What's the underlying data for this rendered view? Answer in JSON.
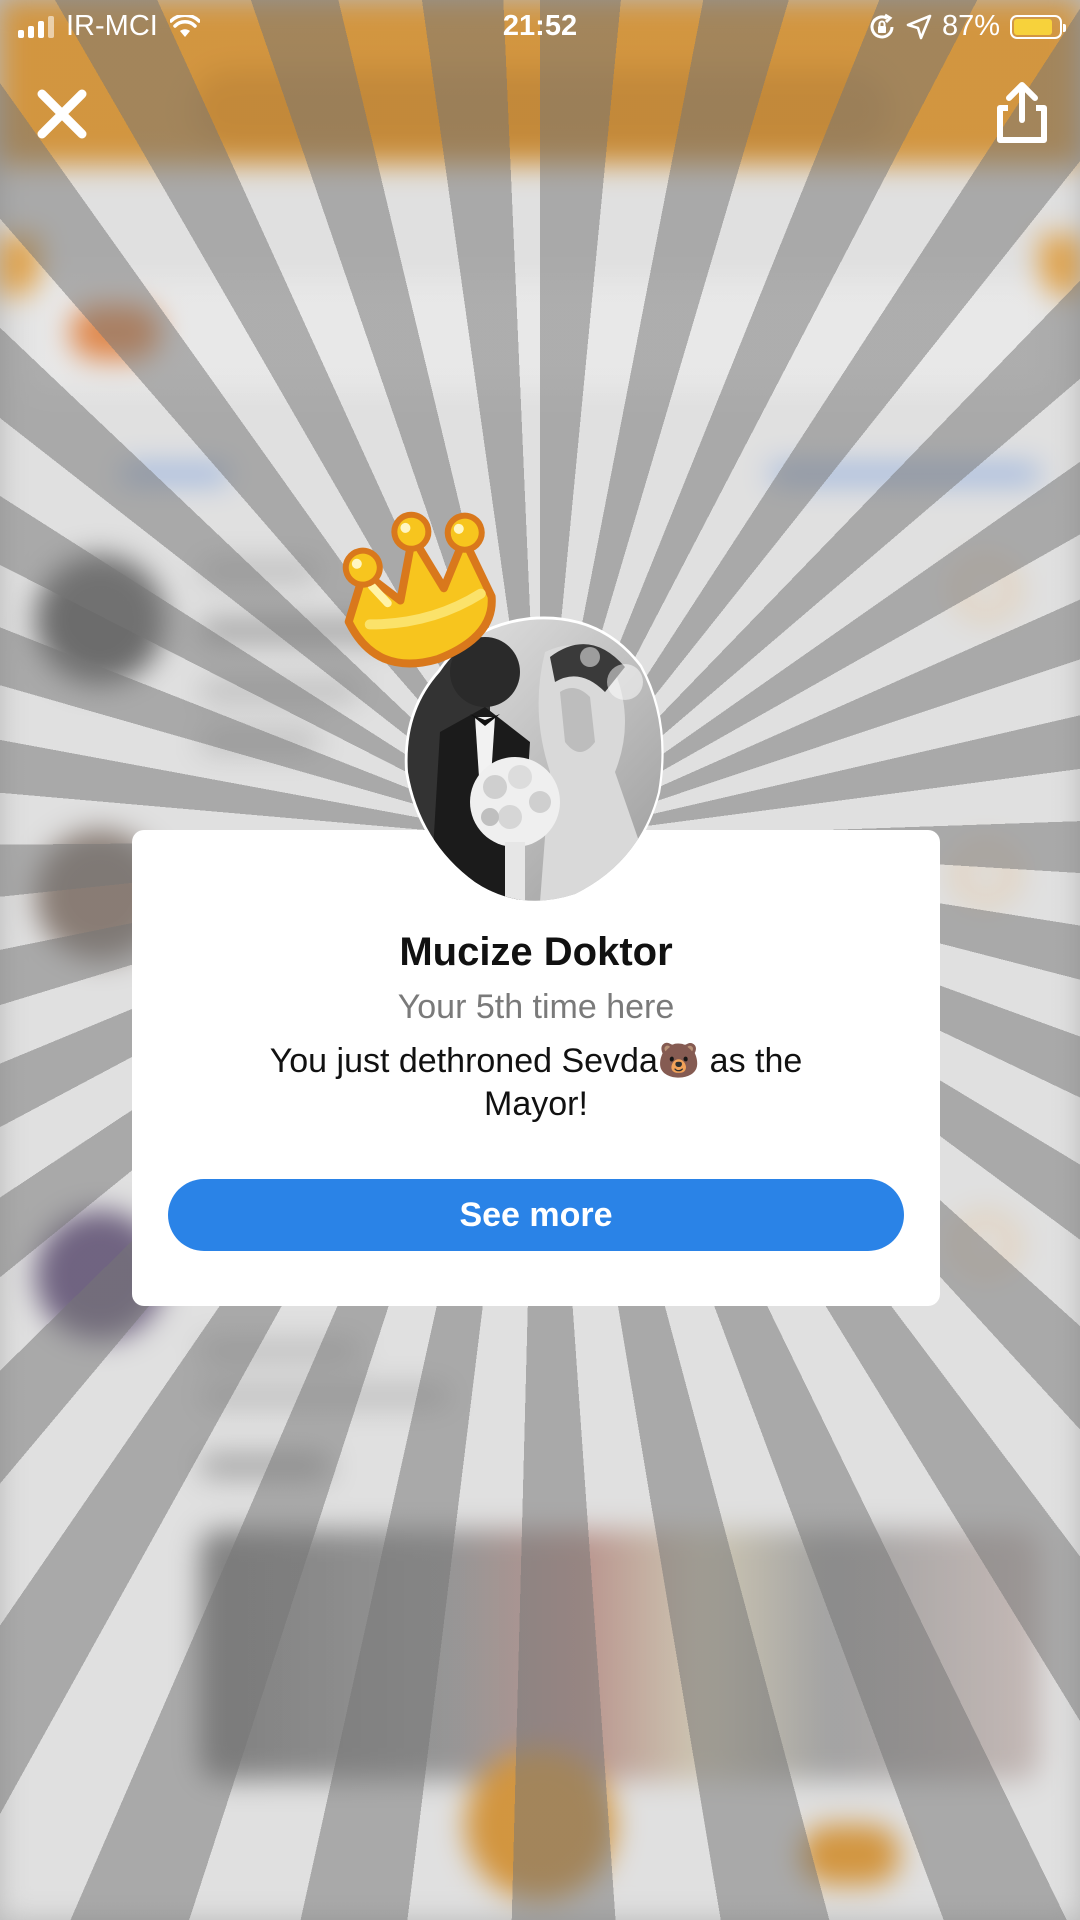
{
  "status_bar": {
    "carrier": "IR-MCI",
    "time": "21:52",
    "battery": "87%",
    "battery_level": 0.87
  },
  "icons": {
    "close": "close-icon",
    "share": "share-icon",
    "wifi": "wifi-icon",
    "signal": "signal-icon",
    "battery": "battery-icon",
    "location": "location-arrow-icon",
    "rotation_lock": "rotation-lock-icon",
    "crown": "crown-icon"
  },
  "modal": {
    "venue_name": "Mucize Doktor",
    "visit_count": "Your 5th time here",
    "message": "You just dethroned Sevda🐻 as the Mayor!",
    "button_label": "See more"
  },
  "colors": {
    "accent_blue": "#2a83e7",
    "header_orange": "#d88a1c",
    "crown_yellow": "#f7c51e",
    "battery_yellow": "#f7d23b"
  }
}
